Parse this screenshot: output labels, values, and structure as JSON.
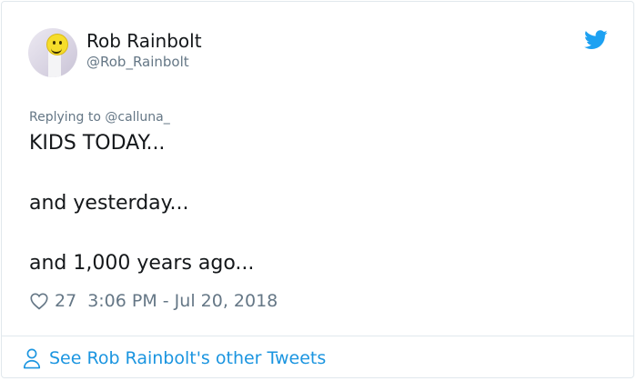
{
  "author": {
    "name": "Rob Rainbolt",
    "handle": "@Rob_Rainbolt"
  },
  "reply": {
    "text": "Replying to @calluna_"
  },
  "tweet": {
    "lines": [
      "KIDS TODAY...",
      "and yesterday...",
      "and 1,000 years ago..."
    ]
  },
  "meta": {
    "like_count": "27",
    "timestamp": "3:06 PM - Jul 20, 2018"
  },
  "footer": {
    "link_text": "See Rob Rainbolt's other Tweets"
  },
  "colors": {
    "twitter_blue": "#1da1f2",
    "link_blue": "#1b95e0",
    "secondary_text": "#657786"
  },
  "icons": [
    "twitter-bird-icon",
    "heart-icon",
    "person-icon"
  ]
}
